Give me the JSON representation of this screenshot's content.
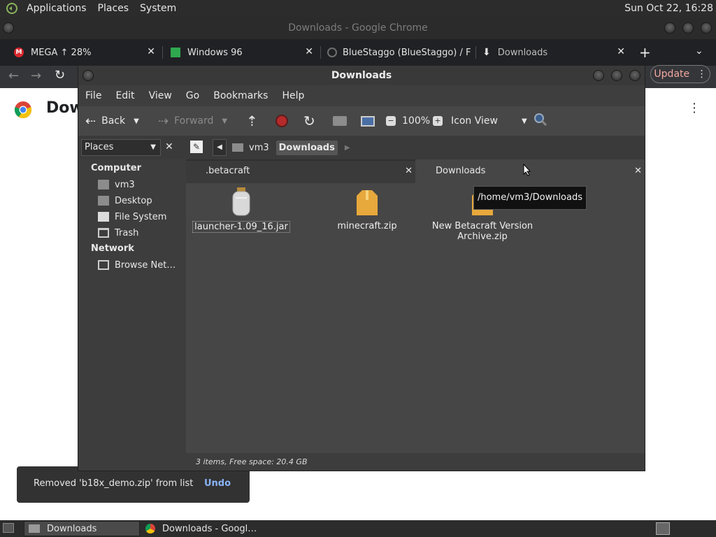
{
  "top_panel": {
    "menus": [
      "Applications",
      "Places",
      "System"
    ],
    "clock": "Sun Oct 22, 16:28"
  },
  "chrome": {
    "window_title": "Downloads - Google Chrome",
    "tabs": [
      {
        "label": "MEGA ↑ 28%",
        "icon": "mega-icon"
      },
      {
        "label": "Windows 96",
        "icon": "windows96-icon"
      },
      {
        "label": "BlueStaggo (BlueStaggo) / F",
        "icon": "github-icon"
      },
      {
        "label": "Downloads",
        "icon": "download-icon"
      }
    ],
    "update_label": "Update",
    "page_heading": "Dow"
  },
  "snackbar": {
    "message": "Removed 'b18x_demo.zip' from list",
    "action": "Undo"
  },
  "file_manager": {
    "title": "Downloads",
    "menu": [
      "File",
      "Edit",
      "View",
      "Go",
      "Bookmarks",
      "Help"
    ],
    "toolbar": {
      "back": "Back",
      "forward": "Forward",
      "zoom": "100%",
      "view_mode": "Icon View"
    },
    "sidebar": {
      "selector": "Places",
      "sections": [
        {
          "heading": "Computer",
          "items": [
            {
              "label": "vm3",
              "icon": "home-folder-icon"
            },
            {
              "label": "Desktop",
              "icon": "desktop-folder-icon"
            },
            {
              "label": "File System",
              "icon": "drive-icon"
            },
            {
              "label": "Trash",
              "icon": "trash-icon"
            }
          ]
        },
        {
          "heading": "Network",
          "items": [
            {
              "label": "Browse Net…",
              "icon": "network-icon"
            }
          ]
        }
      ]
    },
    "breadcrumb": [
      "vm3",
      "Downloads"
    ],
    "tabs": [
      ".betacraft",
      "Downloads"
    ],
    "files": [
      {
        "name": "launcher-1.09_16.jar",
        "icon": "jar-icon"
      },
      {
        "name": "minecraft.zip",
        "icon": "archive-icon"
      },
      {
        "name": "New Betacraft Version Archive.zip",
        "icon": "archive-icon"
      }
    ],
    "tooltip": "/home/vm3/Downloads",
    "status": "3 items, Free space: 20.4 GB"
  },
  "taskbar": {
    "items": [
      "Downloads",
      "Downloads - Googl…"
    ]
  }
}
